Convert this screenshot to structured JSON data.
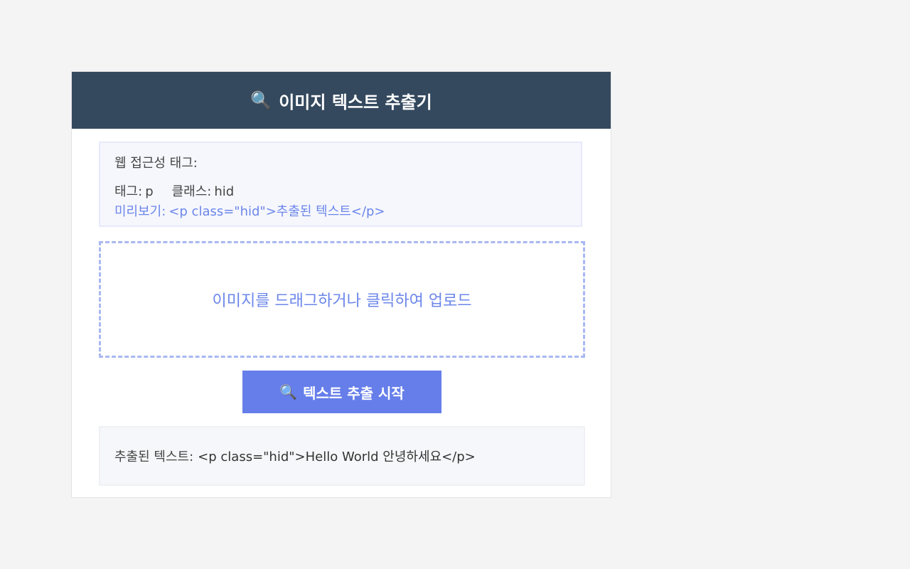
{
  "header": {
    "icon": "magnifier-icon",
    "icon_glyph": "🔍",
    "title": "이미지 텍스트 추출기"
  },
  "tag_panel": {
    "heading": "웹 접근성 태그:",
    "tag_label": "태그:",
    "tag_value": "p",
    "class_label": "클래스:",
    "class_value": "hid",
    "preview_label": "미리보기:",
    "preview_value": "<p class=\"hid\">추출된 텍스트</p>"
  },
  "dropzone": {
    "text": "이미지를 드래그하거나 클릭하여 업로드"
  },
  "extract_button": {
    "icon": "magnifier-icon",
    "icon_glyph": "🔍",
    "label": "텍스트 추출 시작"
  },
  "result": {
    "label": "추출된 텍스트:",
    "value": "<p class=\"hid\">Hello World 안녕하세요</p>"
  },
  "colors": {
    "header_bg": "#34495e",
    "accent": "#667eea",
    "page_bg": "#f4f4f4"
  }
}
